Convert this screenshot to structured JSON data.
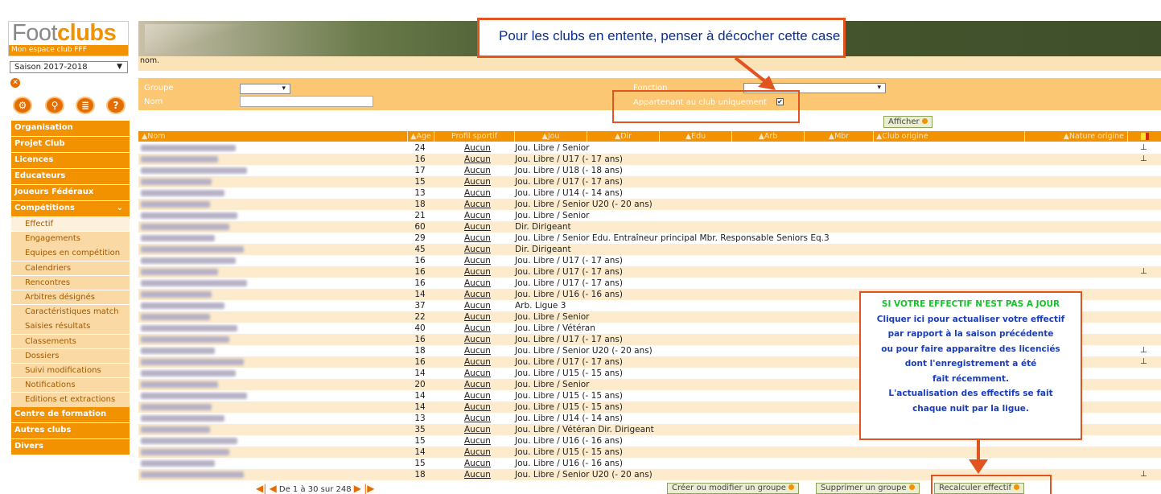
{
  "brand": {
    "name_a": "Foot",
    "name_b": "clubs",
    "subtitle": "Mon espace club FFF"
  },
  "season": {
    "value": "Saison 2017-2018"
  },
  "header": {
    "nom_strip": "nom."
  },
  "sidebar": {
    "sections": [
      "Organisation",
      "Projet Club",
      "Licences",
      "Educateurs",
      "Joueurs Fédéraux",
      "Compétitions"
    ],
    "sub_items": [
      "Effectif",
      "Engagements",
      "Equipes en compétition",
      "Calendriers",
      "Rencontres",
      "Arbitres désignés",
      "Caractéristiques match",
      "Saisies résultats",
      "Classements",
      "Dossiers",
      "Suivi modifications",
      "Notifications",
      "Editions et extractions"
    ],
    "after": [
      "Centre de formation",
      "Autres clubs",
      "Divers"
    ]
  },
  "filter": {
    "groupe_label": "Groupe",
    "nom_label": "Nom",
    "fonction_label": "Fonction",
    "club_only_label": "Appartenant au club uniquement",
    "afficher_button": "Afficher"
  },
  "table": {
    "headers": [
      "▲Nom",
      "▲Age",
      "Profil sportif",
      "▲Jou",
      "▲Dir",
      "▲Edu",
      "▲Arb",
      "▲Mbr",
      "▲Club origine",
      "▲Nature origine"
    ],
    "rows": [
      {
        "age": "24",
        "profil": "Aucun",
        "desc": "Jou. Libre / Senior",
        "flag": "⊥"
      },
      {
        "age": "16",
        "profil": "Aucun",
        "desc": "Jou. Libre / U17 (- 17 ans)",
        "flag": "⊥"
      },
      {
        "age": "17",
        "profil": "Aucun",
        "desc": "Jou. Libre / U18 (- 18 ans)",
        "flag": ""
      },
      {
        "age": "15",
        "profil": "Aucun",
        "desc": "Jou. Libre / U17 (- 17 ans)",
        "flag": ""
      },
      {
        "age": "13",
        "profil": "Aucun",
        "desc": "Jou. Libre / U14 (- 14 ans)",
        "flag": ""
      },
      {
        "age": "18",
        "profil": "Aucun",
        "desc": "Jou. Libre / Senior U20 (- 20 ans)",
        "flag": ""
      },
      {
        "age": "21",
        "profil": "Aucun",
        "desc": "Jou. Libre / Senior",
        "flag": ""
      },
      {
        "age": "60",
        "profil": "Aucun",
        "desc": "Dir. Dirigeant",
        "flag": ""
      },
      {
        "age": "29",
        "profil": "Aucun",
        "desc": "Jou. Libre / Senior Edu. Entraîneur principal Mbr. Responsable Seniors Eq.3",
        "flag": ""
      },
      {
        "age": "45",
        "profil": "Aucun",
        "desc": "Dir. Dirigeant",
        "flag": ""
      },
      {
        "age": "16",
        "profil": "Aucun",
        "desc": "Jou. Libre / U17 (- 17 ans)",
        "flag": ""
      },
      {
        "age": "16",
        "profil": "Aucun",
        "desc": "Jou. Libre / U17 (- 17 ans)",
        "flag": "⊥"
      },
      {
        "age": "16",
        "profil": "Aucun",
        "desc": "Jou. Libre / U17 (- 17 ans)",
        "flag": ""
      },
      {
        "age": "14",
        "profil": "Aucun",
        "desc": "Jou. Libre / U16 (- 16 ans)",
        "flag": ""
      },
      {
        "age": "37",
        "profil": "Aucun",
        "desc": "Arb. Ligue 3",
        "flag": ""
      },
      {
        "age": "22",
        "profil": "Aucun",
        "desc": "Jou. Libre / Senior",
        "flag": ""
      },
      {
        "age": "40",
        "profil": "Aucun",
        "desc": "Jou. Libre / Vétéran",
        "flag": ""
      },
      {
        "age": "16",
        "profil": "Aucun",
        "desc": "Jou. Libre / U17 (- 17 ans)",
        "flag": ""
      },
      {
        "age": "18",
        "profil": "Aucun",
        "desc": "Jou. Libre / Senior U20 (- 20 ans)",
        "flag": "⊥"
      },
      {
        "age": "16",
        "profil": "Aucun",
        "desc": "Jou. Libre / U17 (- 17 ans)",
        "flag": "⊥"
      },
      {
        "age": "14",
        "profil": "Aucun",
        "desc": "Jou. Libre / U15 (- 15 ans)",
        "flag": ""
      },
      {
        "age": "20",
        "profil": "Aucun",
        "desc": "Jou. Libre / Senior",
        "flag": ""
      },
      {
        "age": "14",
        "profil": "Aucun",
        "desc": "Jou. Libre / U15 (- 15 ans)",
        "flag": ""
      },
      {
        "age": "14",
        "profil": "Aucun",
        "desc": "Jou. Libre / U15 (- 15 ans)",
        "flag": ""
      },
      {
        "age": "13",
        "profil": "Aucun",
        "desc": "Jou. Libre / U14 (- 14 ans)",
        "flag": ""
      },
      {
        "age": "35",
        "profil": "Aucun",
        "desc": "Jou. Libre / Vétéran Dir. Dirigeant",
        "flag": ""
      },
      {
        "age": "15",
        "profil": "Aucun",
        "desc": "Jou. Libre / U16 (- 16 ans)",
        "flag": ""
      },
      {
        "age": "14",
        "profil": "Aucun",
        "desc": "Jou. Libre / U15 (- 15 ans)",
        "flag": ""
      },
      {
        "age": "15",
        "profil": "Aucun",
        "desc": "Jou. Libre / U16 (- 16 ans)",
        "flag": ""
      },
      {
        "age": "18",
        "profil": "Aucun",
        "desc": "Jou. Libre / Senior U20 (- 20 ans)",
        "flag": "⊥"
      }
    ]
  },
  "pager": {
    "text": "De 1 à 30 sur 248"
  },
  "buttons": {
    "create_group": "Créer ou modifier un groupe",
    "delete_group": "Supprimer un groupe",
    "recalc": "Recalculer effectif"
  },
  "annotations": {
    "top": "Pour les clubs en entente, penser à décocher cette case",
    "side_title": "SI VOTRE EFFECTIF N'EST PAS A JOUR",
    "side_lines": [
      "Cliquer ici pour actualiser votre effectif",
      "par rapport à la saison précédente",
      "ou pour faire apparaître des licenciés",
      "dont l'enregistrement a été",
      "fait récemment.",
      "L'actualisation des effectifs se fait",
      "chaque nuit par la ligue."
    ]
  },
  "colors": {
    "accent": "#f39200",
    "annotation_red": "#e2541f",
    "annotation_blue": "#1a3db8"
  }
}
